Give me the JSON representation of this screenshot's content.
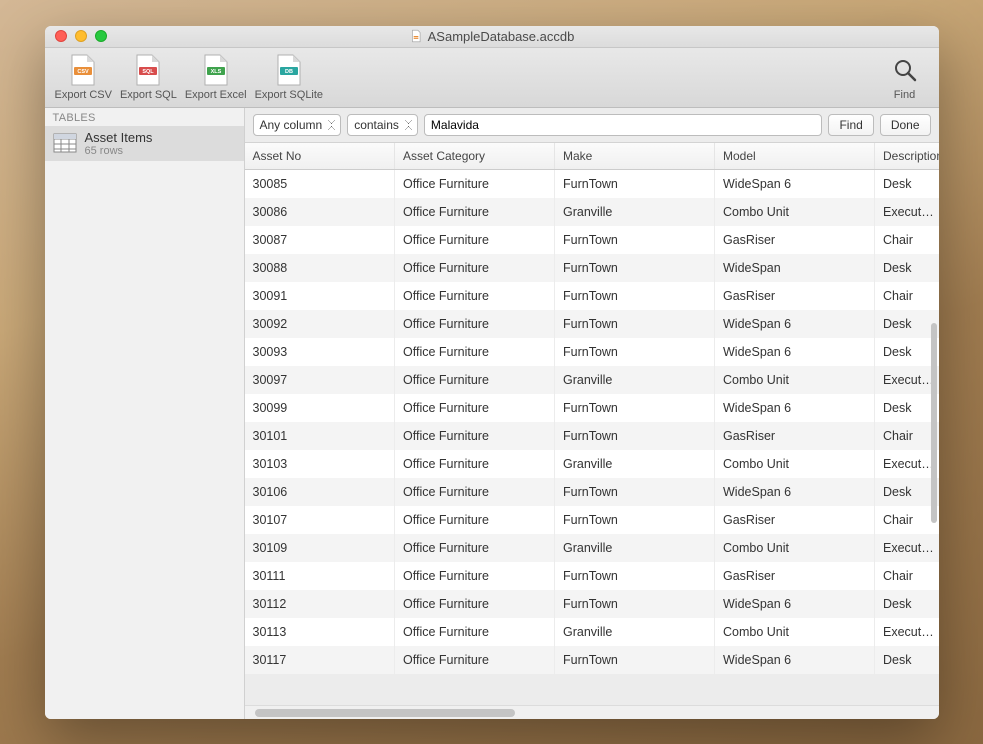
{
  "window": {
    "title": "ASampleDatabase.accdb"
  },
  "toolbar": {
    "export_csv": "Export CSV",
    "export_sql": "Export SQL",
    "export_excel": "Export Excel",
    "export_sqlite": "Export SQLite",
    "find": "Find"
  },
  "sidebar": {
    "header": "TABLES",
    "items": [
      {
        "name": "Asset Items",
        "sub": "65 rows"
      }
    ]
  },
  "filter": {
    "column_select": "Any column",
    "operator_select": "contains",
    "search_value": "Malavida",
    "find_btn": "Find",
    "done_btn": "Done"
  },
  "table": {
    "columns": [
      "Asset No",
      "Asset Category",
      "Make",
      "Model",
      "Description"
    ],
    "rows": [
      {
        "asset_no": "30085",
        "category": "Office Furniture",
        "make": "FurnTown",
        "model": "WideSpan 6",
        "desc": "Desk"
      },
      {
        "asset_no": "30086",
        "category": "Office Furniture",
        "make": "Granville",
        "model": "Combo Unit",
        "desc": "Executive"
      },
      {
        "asset_no": "30087",
        "category": "Office Furniture",
        "make": "FurnTown",
        "model": "GasRiser",
        "desc": "Chair"
      },
      {
        "asset_no": "30088",
        "category": "Office Furniture",
        "make": "FurnTown",
        "model": "WideSpan",
        "desc": "Desk"
      },
      {
        "asset_no": "30091",
        "category": "Office Furniture",
        "make": "FurnTown",
        "model": "GasRiser",
        "desc": "Chair"
      },
      {
        "asset_no": "30092",
        "category": "Office Furniture",
        "make": "FurnTown",
        "model": "WideSpan 6",
        "desc": "Desk"
      },
      {
        "asset_no": "30093",
        "category": "Office Furniture",
        "make": "FurnTown",
        "model": "WideSpan 6",
        "desc": "Desk"
      },
      {
        "asset_no": "30097",
        "category": "Office Furniture",
        "make": "Granville",
        "model": "Combo Unit",
        "desc": "Executive"
      },
      {
        "asset_no": "30099",
        "category": "Office Furniture",
        "make": "FurnTown",
        "model": "WideSpan 6",
        "desc": "Desk"
      },
      {
        "asset_no": "30101",
        "category": "Office Furniture",
        "make": "FurnTown",
        "model": "GasRiser",
        "desc": "Chair"
      },
      {
        "asset_no": "30103",
        "category": "Office Furniture",
        "make": "Granville",
        "model": "Combo Unit",
        "desc": "Executive"
      },
      {
        "asset_no": "30106",
        "category": "Office Furniture",
        "make": "FurnTown",
        "model": "WideSpan 6",
        "desc": "Desk"
      },
      {
        "asset_no": "30107",
        "category": "Office Furniture",
        "make": "FurnTown",
        "model": "GasRiser",
        "desc": "Chair"
      },
      {
        "asset_no": "30109",
        "category": "Office Furniture",
        "make": "Granville",
        "model": "Combo Unit",
        "desc": "Executive"
      },
      {
        "asset_no": "30111",
        "category": "Office Furniture",
        "make": "FurnTown",
        "model": "GasRiser",
        "desc": "Chair"
      },
      {
        "asset_no": "30112",
        "category": "Office Furniture",
        "make": "FurnTown",
        "model": "WideSpan 6",
        "desc": "Desk"
      },
      {
        "asset_no": "30113",
        "category": "Office Furniture",
        "make": "Granville",
        "model": "Combo Unit",
        "desc": "Executive"
      },
      {
        "asset_no": "30117",
        "category": "Office Furniture",
        "make": "FurnTown",
        "model": "WideSpan 6",
        "desc": "Desk"
      }
    ]
  }
}
